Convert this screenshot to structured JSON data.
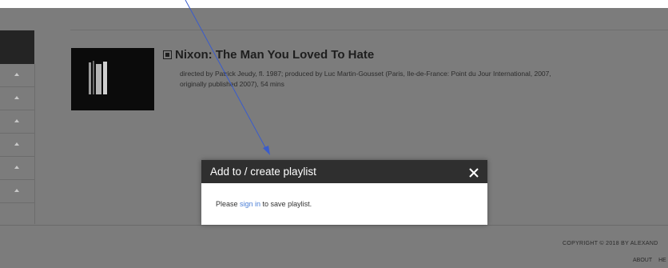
{
  "result": {
    "title": "Nixon: The Man You Loved To Hate",
    "meta": "directed by Patrick Jeudy, fl. 1987; produced by Luc Martin-Gousset (Paris, Ile-de-France: Point du Jour International, 2007, originally published 2007), 54 mins",
    "icon": "film-icon"
  },
  "modal": {
    "title": "Add to / create playlist",
    "prefix": "Please ",
    "link": "sign in",
    "suffix": " to save playlist.",
    "close_icon": "close-icon"
  },
  "footer": {
    "copyright": "COPYRIGHT © 2018 BY ALEXAND",
    "about": "ABOUT",
    "help": "HE"
  },
  "colors": {
    "overlay": "#7c7c7c",
    "modal_header": "#2f2f2f",
    "link": "#4a7ed6",
    "annotation_arrow": "#3a5ccc"
  }
}
